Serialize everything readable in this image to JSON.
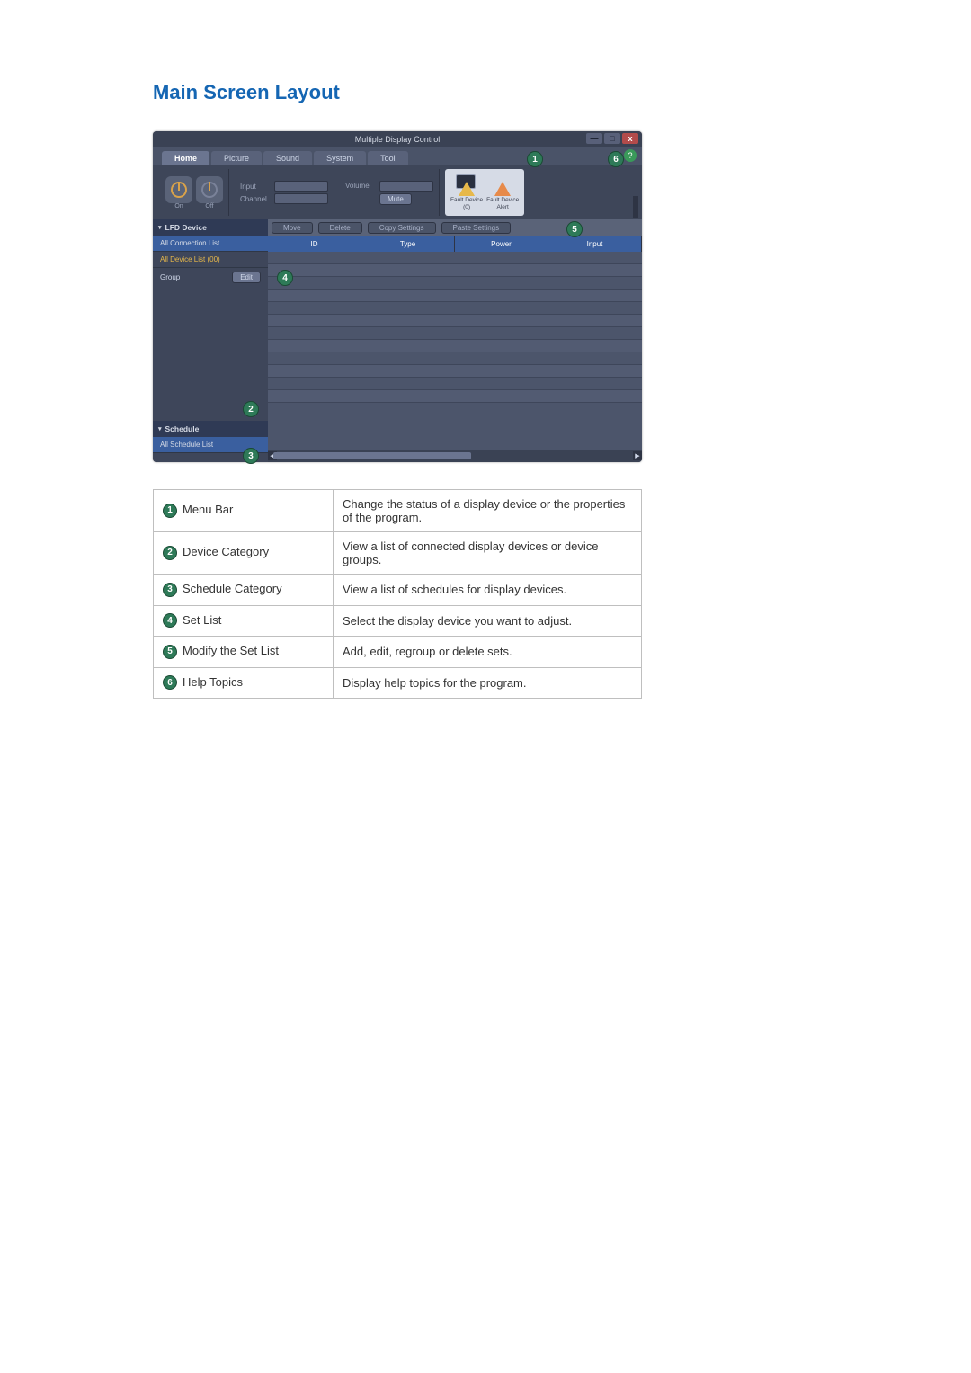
{
  "section_title": "Main Screen Layout",
  "window": {
    "title": "Multiple Display Control",
    "buttons": {
      "minimize": "—",
      "maximize": "□",
      "close": "x"
    }
  },
  "ribbon": {
    "tabs": [
      "Home",
      "Picture",
      "Sound",
      "System",
      "Tool"
    ],
    "active_tab": "Home",
    "group_power": {
      "on": "On",
      "off": "Off"
    },
    "group_input": {
      "input_label": "Input",
      "channel_label": "Channel"
    },
    "group_volume": {
      "volume_label": "Volume",
      "mute_button": "Mute"
    },
    "alerts": {
      "fault_device_count_label": "Fault Device\n(0)",
      "fault_device_alert_label": "Fault Device\nAlert"
    }
  },
  "sidebar": {
    "lfd_header": "LFD Device",
    "all_connection_list": "All Connection List",
    "all_device_list": "All Device List (00)",
    "group_label": "Group",
    "edit_button": "Edit",
    "schedule_header": "Schedule",
    "all_schedule_list": "All Schedule List"
  },
  "toolbar": {
    "move": "Move",
    "delete": "Delete",
    "copy_settings": "Copy Settings",
    "paste_settings": "Paste Settings"
  },
  "table": {
    "columns": [
      "ID",
      "Type",
      "Power",
      "Input"
    ]
  },
  "callouts": {
    "c1": "1",
    "c2": "2",
    "c3": "3",
    "c4": "4",
    "c5": "5",
    "c6": "6"
  },
  "legend": {
    "rows": [
      {
        "n": "1",
        "label": "Menu Bar",
        "desc": "Change the status of a display device or the properties of the program."
      },
      {
        "n": "2",
        "label": "Device Category",
        "desc": "View a list of connected display devices or device groups."
      },
      {
        "n": "3",
        "label": "Schedule Category",
        "desc": "View a list of schedules for display devices."
      },
      {
        "n": "4",
        "label": "Set List",
        "desc": "Select the display device you want to adjust."
      },
      {
        "n": "5",
        "label": "Modify the Set List",
        "desc": "Add, edit, regroup or delete sets."
      },
      {
        "n": "6",
        "label": "Help Topics",
        "desc": "Display help topics for the program."
      }
    ]
  }
}
